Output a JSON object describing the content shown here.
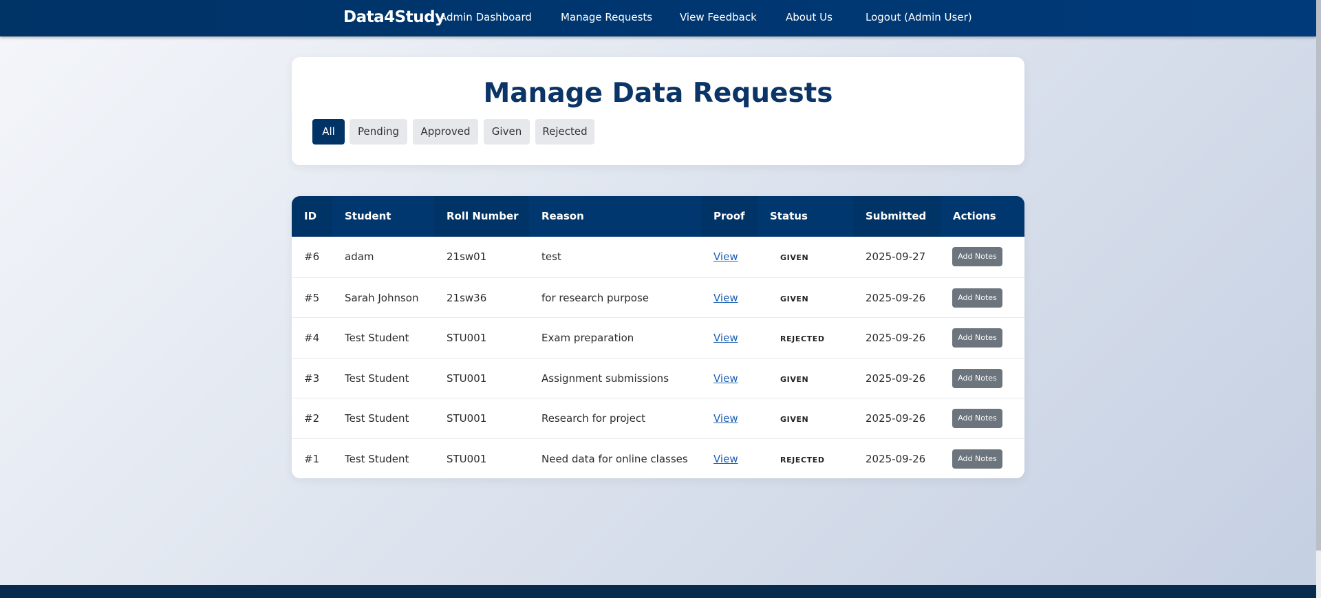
{
  "nav": {
    "brand": "Data4Study",
    "links": [
      "Admin Dashboard",
      "Manage Requests",
      "View Feedback",
      "About Us",
      "Logout (Admin User)"
    ]
  },
  "page": {
    "title": "Manage Data Requests",
    "filters": [
      "All",
      "Pending",
      "Approved",
      "Given",
      "Rejected"
    ],
    "active_filter": "All"
  },
  "table": {
    "headers": [
      "ID",
      "Student",
      "Roll Number",
      "Reason",
      "Proof",
      "Status",
      "Submitted",
      "Actions"
    ],
    "rows": [
      {
        "id": "#6",
        "student": "adam",
        "roll": "21sw01",
        "reason": "test",
        "proof": "View",
        "status": "GIVEN",
        "submitted": "2025-09-27",
        "action": "Add Notes"
      },
      {
        "id": "#5",
        "student": "Sarah Johnson",
        "roll": "21sw36",
        "reason": "for research purpose",
        "proof": "View",
        "status": "GIVEN",
        "submitted": "2025-09-26",
        "action": "Add Notes"
      },
      {
        "id": "#4",
        "student": "Test Student",
        "roll": "STU001",
        "reason": "Exam preparation",
        "proof": "View",
        "status": "REJECTED",
        "submitted": "2025-09-26",
        "action": "Add Notes"
      },
      {
        "id": "#3",
        "student": "Test Student",
        "roll": "STU001",
        "reason": "Assignment submissions",
        "proof": "View",
        "status": "GIVEN",
        "submitted": "2025-09-26",
        "action": "Add Notes"
      },
      {
        "id": "#2",
        "student": "Test Student",
        "roll": "STU001",
        "reason": "Research for project",
        "proof": "View",
        "status": "GIVEN",
        "submitted": "2025-09-26",
        "action": "Add Notes"
      },
      {
        "id": "#1",
        "student": "Test Student",
        "roll": "STU001",
        "reason": "Need data for online classes",
        "proof": "View",
        "status": "REJECTED",
        "submitted": "2025-09-26",
        "action": "Add Notes"
      }
    ]
  },
  "colors": {
    "primary": "#003366",
    "action_button": "#6c757d",
    "link": "#1a5fb4"
  }
}
